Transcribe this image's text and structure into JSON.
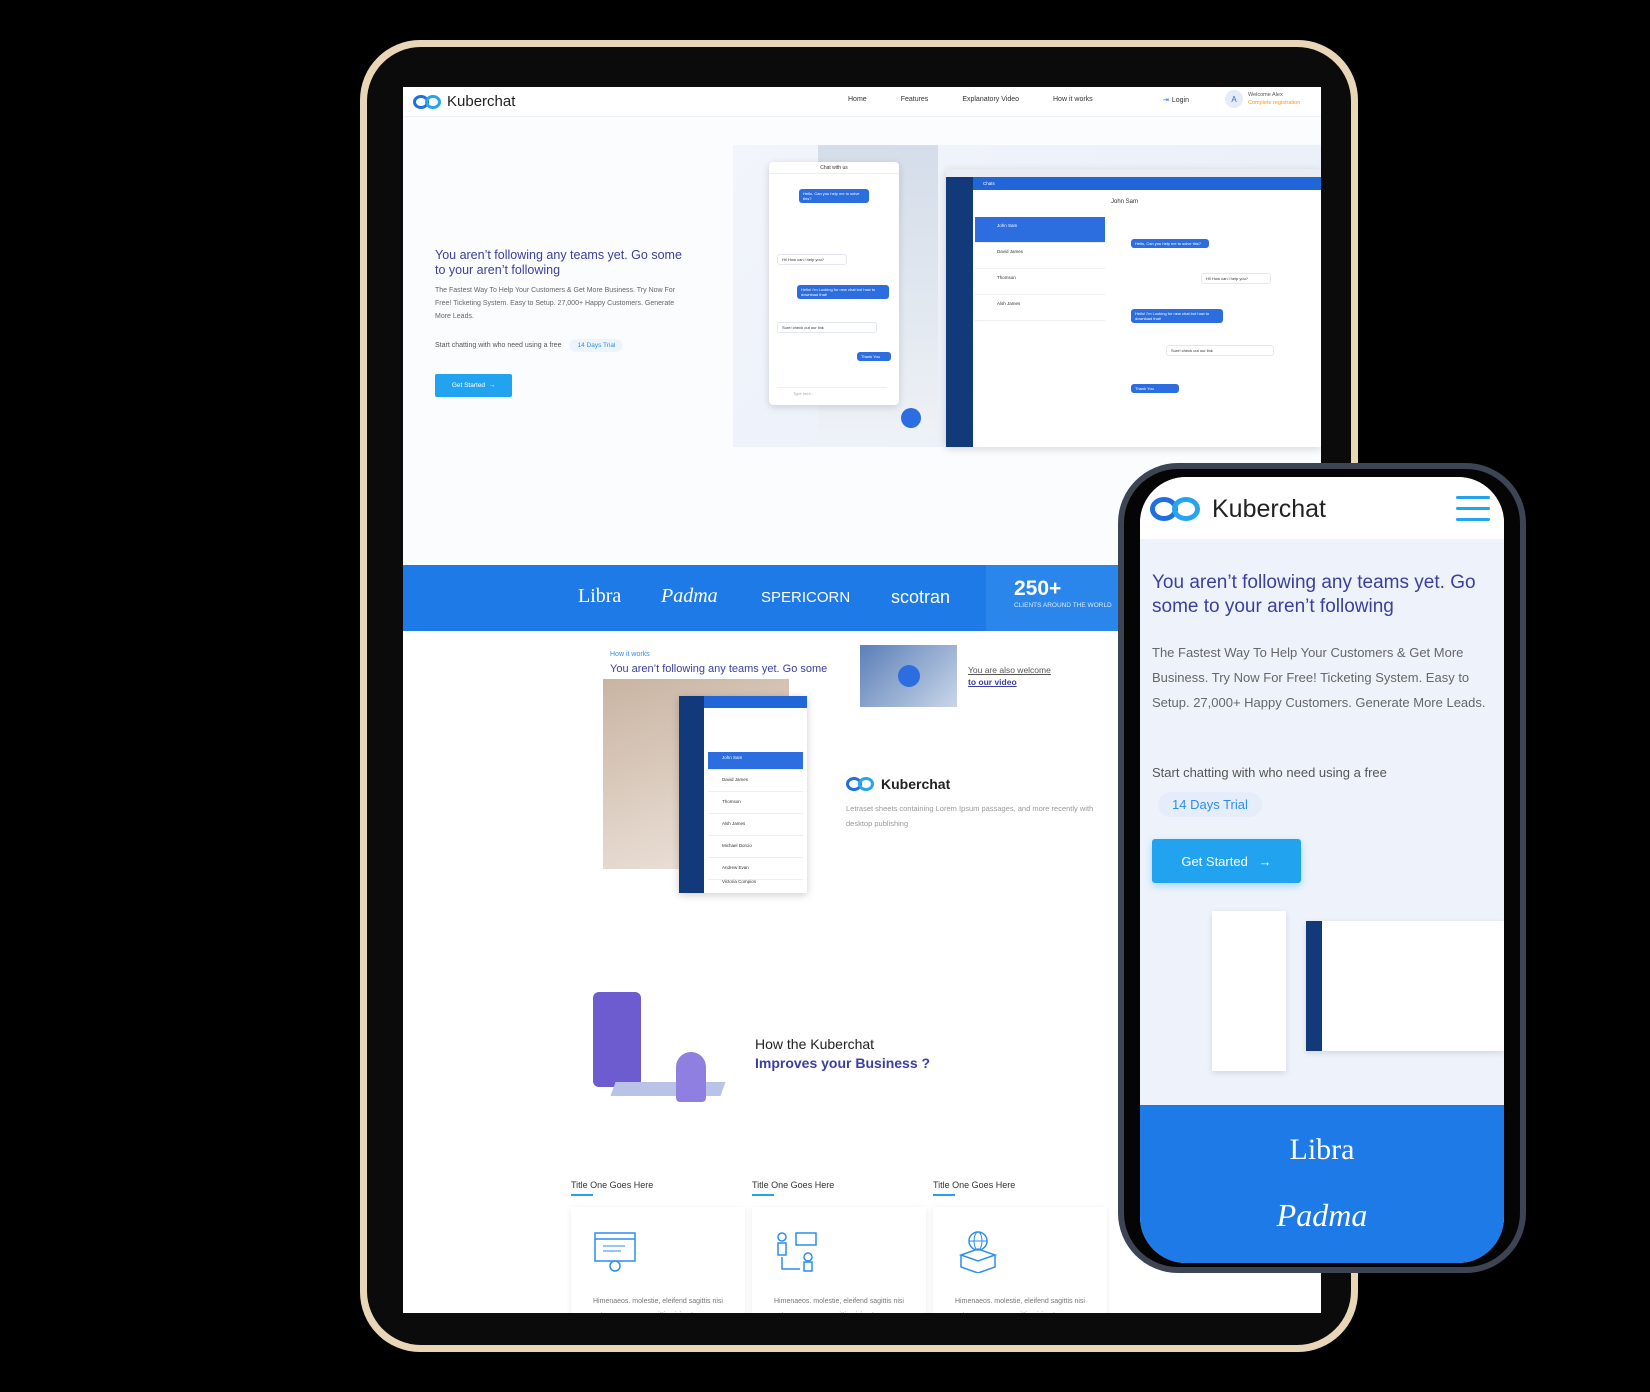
{
  "brand": {
    "name": "Kuberchat",
    "accent": "#1e7ae6",
    "cta": "#22a3f0",
    "heading": "#3a3fa0"
  },
  "tablet": {
    "nav": {
      "links": [
        "Home",
        "Features",
        "Explanatory Video",
        "How it works"
      ],
      "login": "Login",
      "avatar": "A",
      "welcome": "Welcome Alex",
      "complete": "Complete registration"
    },
    "hero": {
      "title": "You aren’t following any teams yet. Go some to your aren’t following",
      "desc": "The Fastest Way To Help Your Customers & Get More Business. Try Now For Free! Ticketing System. Easy to Setup. 27,000+ Happy Customers. Generate More Leads.",
      "trial_text": "Start chatting with who need using a free",
      "trial_badge": "14 Days Trial",
      "cta": "Get Started"
    },
    "chat_widget": {
      "header": "Chat with us",
      "messages": [
        "Hello, Can you help me to solve this?",
        "Hi! How can i help you?",
        "Hello! I'm Looking for new chat bot how to download that!",
        "Sure! check out our link",
        "Thank You"
      ],
      "input_placeholder": "Type here..."
    },
    "dashboard": {
      "header": "Chats",
      "contact": "John Sam",
      "contacts": [
        "John Sam",
        "David James",
        "Thomson",
        "Alsh James"
      ]
    },
    "brands": [
      "Libra",
      "Padma",
      "SPERICORN",
      "scotran"
    ],
    "stat": {
      "number": "250+",
      "caption": "CLIENTS AROUND THE WORLD"
    },
    "how": {
      "label": "How it works",
      "title": "You aren’t following any teams yet. Go some to your aren’t following",
      "video_line1": "You are also welcome",
      "video_line2": "to our video"
    },
    "feature": {
      "name": "Kuberchat",
      "desc": "Letraset sheets containing Lorem Ipsum passages, and more recently with desktop publishing",
      "contacts": [
        "John Sam",
        "David James",
        "Thomson",
        "Alsh James",
        "Michael Dorcio",
        "Andrew Evan",
        "Victoria Compion"
      ]
    },
    "improve": {
      "line1": "How the Kuberchat",
      "line2": "Improves your Business ?"
    },
    "cards": [
      {
        "title": "Title One Goes Here",
        "text": "Himenaeos. molestie, eleifend sagittis nisi ante arcuenaeos sagittis nisi ante arcu.",
        "icon": "browser-settings-icon"
      },
      {
        "title": "Title One Goes Here",
        "text": "Himenaeos. molestie, eleifend sagittis nisi ante arcuenaeos sagittis nisi ante arcu.",
        "icon": "people-chat-icon"
      },
      {
        "title": "Title One Goes Here",
        "text": "Himenaeos. molestie, eleifend sagittis nisi ante arcuenaeos sagittis nisi ante arcu.",
        "icon": "globe-box-icon"
      }
    ]
  },
  "phone": {
    "hero": {
      "title": "You aren’t following any teams yet. Go some to your aren’t following",
      "desc": "The Fastest Way To Help Your Customers & Get More Business. Try Now For Free! Ticketing System. Easy to Setup. 27,000+ Happy Customers. Generate More Leads.",
      "trial_text": "Start chatting with who need using a free",
      "trial_badge": "14 Days Trial",
      "cta": "Get Started"
    },
    "brands": [
      "Libra",
      "Padma"
    ]
  }
}
